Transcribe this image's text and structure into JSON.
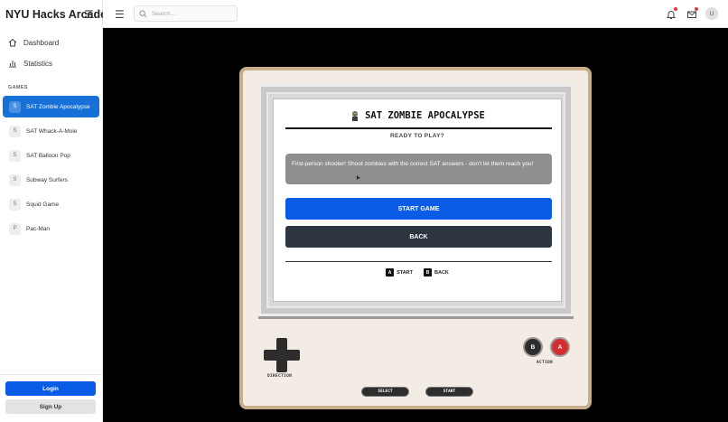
{
  "app": {
    "title": "NYU Hacks Arcade"
  },
  "sidebar": {
    "nav": [
      {
        "label": "Dashboard",
        "icon": "home-icon"
      },
      {
        "label": "Statistics",
        "icon": "bar-chart-icon"
      }
    ],
    "section_label": "GAMES",
    "games": [
      {
        "initial": "S",
        "label": "SAT Zombie Apocalypse",
        "active": true
      },
      {
        "initial": "S",
        "label": "SAT Whack-A-Mole"
      },
      {
        "initial": "S",
        "label": "SAT Balloon Pop"
      },
      {
        "initial": "S",
        "label": "Subway Surfers"
      },
      {
        "initial": "S",
        "label": "Squid Game"
      },
      {
        "initial": "P",
        "label": "Pac-Man"
      }
    ],
    "login_label": "Login",
    "signup_label": "Sign Up"
  },
  "topbar": {
    "search_placeholder": "Search...",
    "user_initial": "U"
  },
  "game": {
    "title": "SAT ZOMBIE APOCALYPSE",
    "subtitle": "READY TO PLAY?",
    "description": "First-person shooter! Shoot zombies with the correct SAT answers - don't let them reach you!",
    "start_label": "START GAME",
    "back_label": "BACK",
    "hints": [
      {
        "key": "A",
        "label": "START"
      },
      {
        "key": "B",
        "label": "BACK"
      }
    ]
  },
  "console": {
    "direction_label": "DIRECTION",
    "action_label": "ACTION",
    "b_label": "B",
    "a_label": "A",
    "select_label": "SELECT",
    "start_label": "START"
  },
  "colors": {
    "accent": "#0a5be6",
    "active_nav": "#1670d8",
    "dark_button": "#2d3640",
    "a_button": "#d32f2f",
    "console_body": "#f3ece5",
    "console_border": "#c9ae8d"
  }
}
